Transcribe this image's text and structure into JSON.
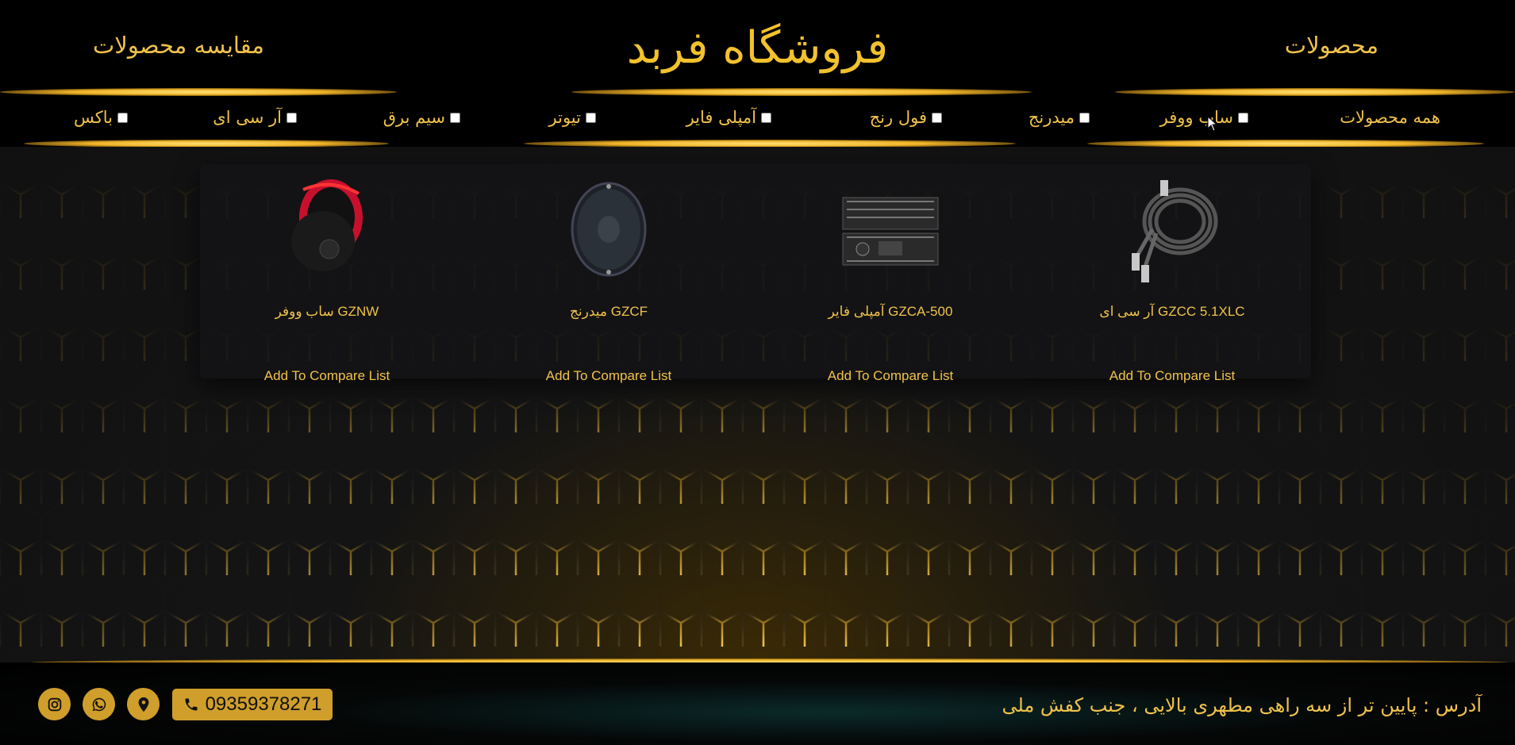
{
  "header": {
    "title": "فروشگاه فربد",
    "nav_products": "محصولات",
    "nav_compare": "مقایسه محصولات"
  },
  "filters": {
    "all": "همه محصولات",
    "items": [
      {
        "label": "ساب ووفر",
        "checked": false
      },
      {
        "label": "میدرنج",
        "checked": false
      },
      {
        "label": "فول رنج",
        "checked": false
      },
      {
        "label": "آمپلی فایر",
        "checked": false
      },
      {
        "label": "تیوتر",
        "checked": false
      },
      {
        "label": "سیم برق",
        "checked": false
      },
      {
        "label": "آر سی ای",
        "checked": false
      },
      {
        "label": "باکس",
        "checked": false
      }
    ]
  },
  "products": [
    {
      "title": "آر سی ای GZCC 5.1XLC",
      "compare_label": "Add To Compare List",
      "image": "rca-cable"
    },
    {
      "title": "آمپلی فایر GZCA-500",
      "compare_label": "Add To Compare List",
      "image": "amplifier"
    },
    {
      "title": "میدرنج GZCF",
      "compare_label": "Add To Compare List",
      "image": "midrange-speaker"
    },
    {
      "title": "ساب ووفر GZNW",
      "compare_label": "Add To Compare List",
      "image": "subwoofer"
    }
  ],
  "footer": {
    "address": "آدرس : پایین تر از سه راهی مطهری بالایی ، جنب کفش ملی",
    "phone": "09359378271",
    "icons": [
      "phone-icon",
      "location-icon",
      "whatsapp-icon",
      "instagram-icon"
    ]
  },
  "colors": {
    "accent": "#f0c24b",
    "button": "#cf9e2b",
    "background": "#000000"
  }
}
